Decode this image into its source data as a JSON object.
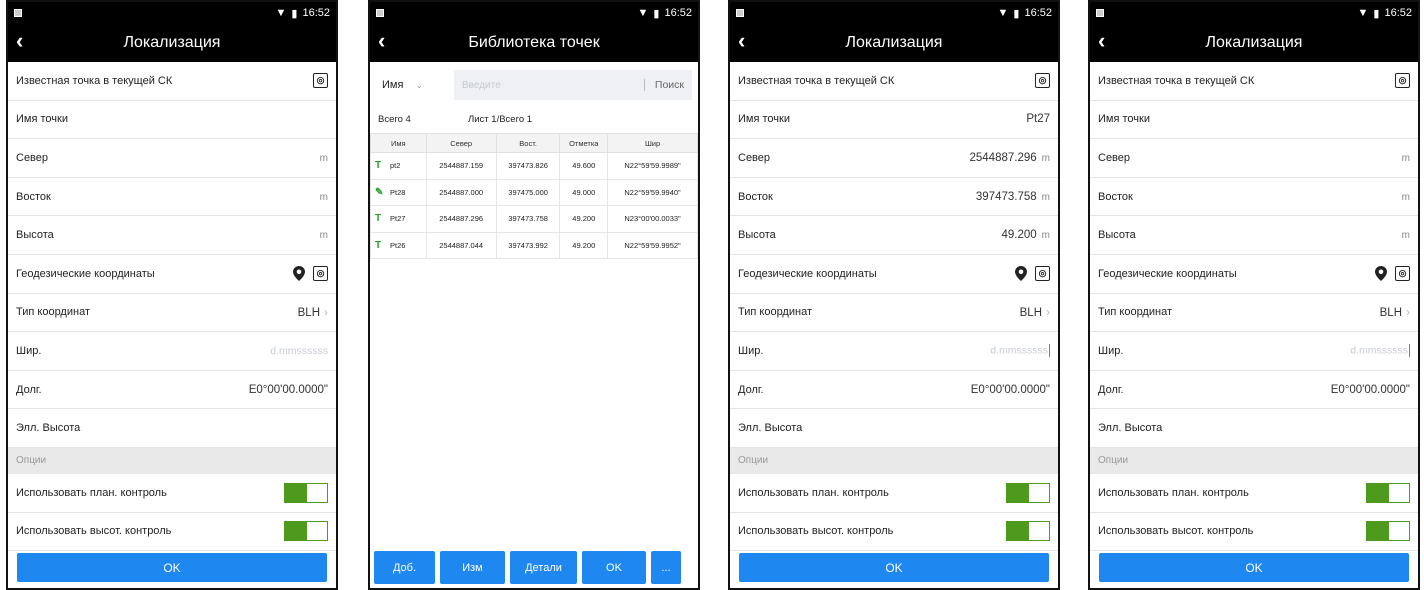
{
  "status": {
    "time": "16:52"
  },
  "colors": {
    "accent": "#1e88f0",
    "toggle_on": "#4e9a1e",
    "header": "#000000"
  },
  "icons": {
    "back": "back-arrow-icon",
    "pin": "location-pin-icon",
    "gps": "gps-locate-icon",
    "marker": "survey-marker-icon",
    "pen": "pencil-icon"
  },
  "screens": [
    {
      "title": "Локализация",
      "known_point_label": "Известная точка в текущей СК",
      "point_name_label": "Имя точки",
      "point_name_value": "",
      "north_label": "Север",
      "north_value": "",
      "north_unit": "m",
      "east_label": "Восток",
      "east_value": "",
      "east_unit": "m",
      "height_label": "Высота",
      "height_value": "",
      "height_unit": "m",
      "geodetic_label": "Геодезические координаты",
      "coord_type_label": "Тип координат",
      "coord_type_value": "BLH",
      "lat_label": "Шир.",
      "lat_placeholder": "d.mmssssss",
      "lon_label": "Долг.",
      "lon_value": "E0°00'00.0000\"",
      "ell_height_label": "Элл. Высота",
      "options_label": "Опции",
      "plan_control_label": "Использовать план. контроль",
      "height_control_label": "Использовать высот. контроль",
      "ok_label": "OK"
    },
    {
      "title": "Библиотека точек",
      "search_field": "Имя",
      "search_placeholder": "Введите",
      "search_button": "Поиск",
      "total": "Всего 4",
      "page": "Лист 1/Всего 1",
      "columns": [
        "Имя",
        "Север",
        "Вост.",
        "Отметка",
        "Шир"
      ],
      "rows": [
        {
          "icon": "marker",
          "name": "pt2",
          "north": "2544887.159",
          "east": "397473.826",
          "elev": "49.600",
          "lat": "N22°59'59.9989\""
        },
        {
          "icon": "pen",
          "name": "Pt28",
          "north": "2544887.000",
          "east": "397475.000",
          "elev": "49.000",
          "lat": "N22°59'59.9940\""
        },
        {
          "icon": "marker",
          "name": "Pt27",
          "north": "2544887.296",
          "east": "397473.758",
          "elev": "49.200",
          "lat": "N23°00'00.0033\""
        },
        {
          "icon": "marker",
          "name": "Pt26",
          "north": "2544887.044",
          "east": "397473.992",
          "elev": "49.200",
          "lat": "N22°59'59.9952\""
        }
      ],
      "buttons": [
        "Доб.",
        "Изм",
        "Детали",
        "OK",
        "..."
      ]
    },
    {
      "title": "Локализация",
      "known_point_label": "Известная точка в текущей СК",
      "point_name_label": "Имя точки",
      "point_name_value": "Pt27",
      "north_label": "Север",
      "north_value": "2544887.296",
      "north_unit": "m",
      "east_label": "Восток",
      "east_value": "397473.758",
      "east_unit": "m",
      "height_label": "Высота",
      "height_value": "49.200",
      "height_unit": "m",
      "geodetic_label": "Геодезические координаты",
      "coord_type_label": "Тип координат",
      "coord_type_value": "BLH",
      "lat_label": "Шир.",
      "lat_placeholder": "d.mmssssss",
      "lon_label": "Долг.",
      "lon_value": "E0°00'00.0000\"",
      "ell_height_label": "Элл. Высота",
      "options_label": "Опции",
      "plan_control_label": "Использовать план. контроль",
      "height_control_label": "Использовать высот. контроль",
      "ok_label": "OK"
    },
    {
      "title": "Локализация",
      "known_point_label": "Известная точка в текущей СК",
      "point_name_label": "Имя точки",
      "point_name_value": "",
      "north_label": "Север",
      "north_value": "",
      "north_unit": "m",
      "east_label": "Восток",
      "east_value": "",
      "east_unit": "m",
      "height_label": "Высота",
      "height_value": "",
      "height_unit": "m",
      "geodetic_label": "Геодезические координаты",
      "coord_type_label": "Тип координат",
      "coord_type_value": "BLH",
      "lat_label": "Шир.",
      "lat_placeholder": "d.mmssssss",
      "lon_label": "Долг.",
      "lon_value": "E0°00'00.0000\"",
      "ell_height_label": "Элл. Высота",
      "options_label": "Опции",
      "plan_control_label": "Использовать план. контроль",
      "height_control_label": "Использовать высот. контроль",
      "ok_label": "OK"
    }
  ]
}
